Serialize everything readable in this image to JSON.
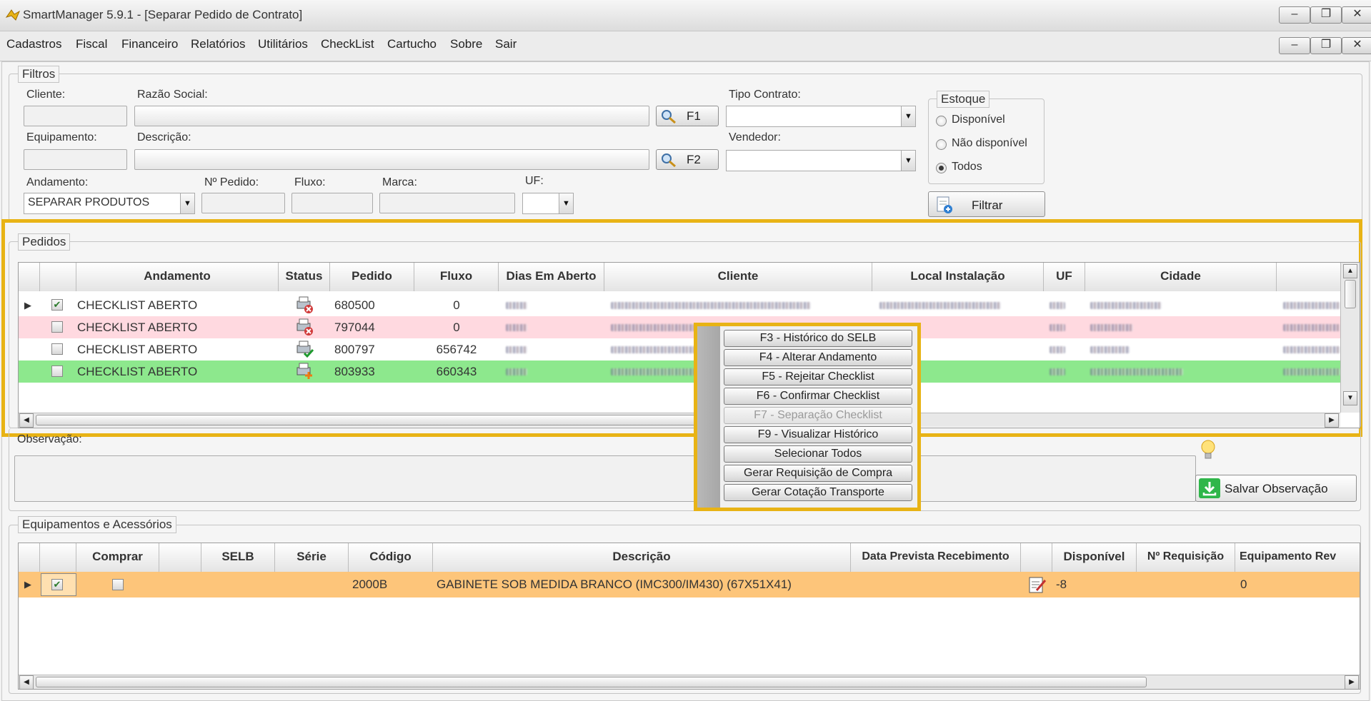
{
  "window": {
    "title": "SmartManager 5.9.1 - [Separar Pedido de Contrato]"
  },
  "window_controls": {
    "minimize": "–",
    "maximize": "❐",
    "close": "✕"
  },
  "menu": [
    "Cadastros",
    "Fiscal",
    "Financeiro",
    "Relatórios",
    "Utilitários",
    "CheckList",
    "Cartucho",
    "Sobre",
    "Sair"
  ],
  "filtros": {
    "legend": "Filtros",
    "cliente_label": "Cliente:",
    "razao_social_label": "Razão Social:",
    "f1_label": "F1",
    "tipo_contrato_label": "Tipo Contrato:",
    "equipamento_label": "Equipamento:",
    "descricao_label": "Descrição:",
    "f2_label": "F2",
    "vendedor_label": "Vendedor:",
    "andamento_label": "Andamento:",
    "andamento_value": "SEPARAR PRODUTOS",
    "pedido_label": "Nº Pedido:",
    "fluxo_label": "Fluxo:",
    "marca_label": "Marca:",
    "uf_label": "UF:",
    "estoque": {
      "legend": "Estoque",
      "opt1": "Disponível",
      "opt2": "Não disponível",
      "opt3": "Todos",
      "selected": "Todos"
    },
    "filtrar_label": "Filtrar"
  },
  "pedidos": {
    "legend": "Pedidos",
    "columns": {
      "andamento": "Andamento",
      "status": "Status",
      "pedido": "Pedido",
      "fluxo": "Fluxo",
      "dias": "Dias Em Aberto",
      "cliente": "Cliente",
      "local": "Local Instalação",
      "uf": "UF",
      "cidade": "Cidade"
    },
    "rows": [
      {
        "andamento": "CHECKLIST ABERTO",
        "pedido": "680500",
        "fluxo": "0",
        "checked": "✔",
        "status_icon": "printer-error-icon"
      },
      {
        "andamento": "CHECKLIST ABERTO",
        "pedido": "797044",
        "fluxo": "0",
        "checked": "",
        "status_icon": "printer-error-icon"
      },
      {
        "andamento": "CHECKLIST ABERTO",
        "pedido": "800797",
        "fluxo": "656742",
        "checked": "",
        "status_icon": "printer-check-icon"
      },
      {
        "andamento": "CHECKLIST ABERTO",
        "pedido": "803933",
        "fluxo": "660343",
        "checked": "",
        "status_icon": "printer-add-icon"
      }
    ],
    "row_colors": [
      "#ffffff",
      "#ffd9e0",
      "#ffffff",
      "#8de88d"
    ]
  },
  "observacao": {
    "label": "Observação:",
    "salvar_label": "Salvar Observação"
  },
  "context_menu": {
    "items": [
      "F3 - Histórico do SELB",
      "F4 - Alterar Andamento",
      "F5 - Rejeitar Checklist",
      "F6 - Confirmar Checklist",
      "F7 - Separação Checklist",
      "F9 - Visualizar Histórico",
      "Selecionar Todos",
      "Gerar Requisição de Compra",
      "Gerar Cotação Transporte"
    ],
    "disabled_item": "F7 - Separação Checklist"
  },
  "equipamentos": {
    "legend": "Equipamentos e Acessórios",
    "columns": {
      "comprar": "Comprar",
      "selb": "SELB",
      "serie": "Série",
      "codigo": "Código",
      "descricao": "Descrição",
      "data_prevista": "Data Prevista Recebimento",
      "disponivel": "Disponível",
      "requisicao": "Nº Requisição",
      "equip_rev": "Equipamento Rev"
    },
    "rows": [
      {
        "checked": "✔",
        "comprar": "",
        "codigo": "2000B",
        "descricao": "GABINETE SOB MEDIDA BRANCO (IMC300/IM430) (67X51X41)",
        "disponivel": "-8",
        "equip_rev": "0"
      }
    ],
    "row_color": "#fdc57a"
  },
  "colors": {
    "highlight": "#e8b315",
    "green_row": "#8de88d",
    "pink_row": "#ffd9e0",
    "orange_row": "#fdc57a"
  }
}
